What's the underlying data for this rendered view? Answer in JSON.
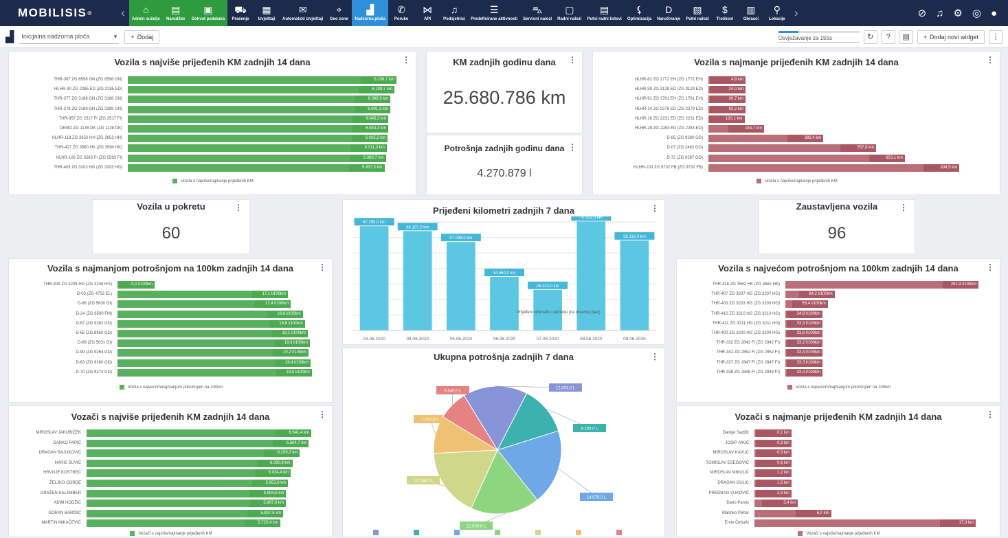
{
  "app": {
    "logo": "MOBILISIS",
    "logo_reg": "®"
  },
  "nav": [
    {
      "label": "Admin sučelje",
      "glyph": "⌂",
      "icon": "admin-icon",
      "state": "green"
    },
    {
      "label": "Narudžbe",
      "glyph": "▤",
      "icon": "orders-icon",
      "state": "green"
    },
    {
      "label": "Dohvat podataka",
      "glyph": "▣",
      "icon": "data-icon",
      "state": "green"
    },
    {
      "label": "Praćenje",
      "glyph": "⛟",
      "icon": "tracking-icon",
      "state": ""
    },
    {
      "label": "Izvještaji",
      "glyph": "▦",
      "icon": "reports-icon",
      "state": ""
    },
    {
      "label": "Automatski izvještaji",
      "glyph": "✉",
      "icon": "auto-reports-icon",
      "state": ""
    },
    {
      "label": "Geo zone",
      "glyph": "⌖",
      "icon": "geozone-icon",
      "state": ""
    },
    {
      "label": "Nadzorna ploča",
      "glyph": "▟",
      "icon": "dashboard-icon",
      "state": "active"
    },
    {
      "label": "Poruke",
      "glyph": "✆",
      "icon": "messages-icon",
      "state": ""
    },
    {
      "label": "API",
      "glyph": "⋈",
      "icon": "api-icon",
      "state": ""
    },
    {
      "label": "Podsjetnici",
      "glyph": "♫",
      "icon": "reminders-icon",
      "state": ""
    },
    {
      "label": "Predefinirane aktivnosti",
      "glyph": "☰",
      "icon": "activities-icon",
      "state": ""
    },
    {
      "label": "Servisni nalozi",
      "glyph": "⛍",
      "icon": "service-icon",
      "state": ""
    },
    {
      "label": "Radni nalozi",
      "glyph": "▢",
      "icon": "work-orders-icon",
      "state": ""
    },
    {
      "label": "Putni radni listovi",
      "glyph": "▤",
      "icon": "travel-sheets-icon",
      "state": ""
    },
    {
      "label": "Optimizacija",
      "glyph": "⚸",
      "icon": "optimization-icon",
      "state": ""
    },
    {
      "label": "Naručivanje",
      "glyph": "D",
      "icon": "ordering-icon",
      "state": ""
    },
    {
      "label": "Putni nalozi",
      "glyph": "▧",
      "icon": "travel-orders-icon",
      "state": ""
    },
    {
      "label": "Troškovi",
      "glyph": "$",
      "icon": "costs-icon",
      "state": ""
    },
    {
      "label": "Obrasci",
      "glyph": "▥",
      "icon": "forms-icon",
      "state": ""
    },
    {
      "label": "Lokacije",
      "glyph": "⚲",
      "icon": "locations-icon",
      "state": ""
    }
  ],
  "toolbar": {
    "dashboard_name": "Inicijalna nadzorna ploča",
    "add_label": "Dodaj",
    "refresh_text": "Osvježavanje za 155s",
    "refresh_progress": 0.25,
    "add_widget_label": "Dodaj novi widget"
  },
  "widgets": {
    "km_year": {
      "title": "KM zadnjih godinu dana",
      "value": "25.680.786 km"
    },
    "fuel_year": {
      "title": "Potrošnja zadnjih godinu dana",
      "value": "4.270.879 l"
    },
    "moving": {
      "title": "Vozila u pokretu",
      "value": "60"
    },
    "stopped": {
      "title": "Zaustavljena vozila",
      "value": "96"
    }
  },
  "chart_data": [
    {
      "id": "most_km",
      "type": "bar",
      "orientation": "horizontal",
      "title": "Vozila s najviše prijeđenih KM zadnjih 14 dana",
      "legend": "Vozila s najviše/najmanje prijeđenih KM",
      "color": "#59b05e",
      "xlim": [
        0,
        6300
      ],
      "categories": [
        "THR-387 ZG 8598 GN (ZG 8598 GN)",
        "HLHR-30 ZG 2285 ED (ZG 2285 ED)",
        "THR-377 ZG 3188 GN (ZG 3188 GN)",
        "THR-378 ZG 3189 GN (ZG 3189 GN)",
        "THR-357 ZG 2517 FI (ZG 2517 FI)",
        "DEMO ZG 1138 DK (ZG 1138 DK)",
        "HLHR-118 ZG 2652 HH (ZG 2652 HH)",
        "THR-417 ZG 3560 HK (ZG 3560 HK)",
        "HLHR-106 ZG 5583 FI (ZG 5583 FI)",
        "THR-403 ZG 3203 HG (ZG 3203 HG)"
      ],
      "values": [
        6236.7,
        6189.7,
        6096.9,
        6091.3,
        6045.3,
        6043.3,
        6035.3,
        6011.3,
        5989.7,
        5957.3
      ],
      "labels": [
        "6.236,7 km",
        "6.189,7 km",
        "6.096,9 km",
        "6.091,3 km",
        "6.045,3 km",
        "6.043,3 km",
        "6.035,3 km",
        "6.011,3 km",
        "5.989,7 km",
        "5.957,3 km"
      ]
    },
    {
      "id": "least_km",
      "type": "bar",
      "orientation": "horizontal",
      "title": "Vozila s najmanje prijeđenih KM zadnjih 14 dana",
      "legend": "Vozila s najviše/najmanje prijeđenih KM",
      "color": "#b96e78",
      "xlim": [
        0,
        900
      ],
      "categories": [
        "HLHR-82 ZG 1772 EH (ZG 1772 EH)",
        "HLHR-59 ZG 3129 ED (ZG 3129 ED)",
        "HLHR-91 ZG 1761 EH (ZG 1761 EH)",
        "HLHR-14 ZG 2279 ED (ZG 2279 ED)",
        "HLHR-16 ZG 2231 ED (ZG 2231 ED)",
        "HLHR-28 ZG 2283 ED (ZG 2283 ED)",
        "D-85 (ZG 9280 GD)",
        "D-07 (ZG 2462 GD)",
        "D-72 (ZG 9287 GD)",
        "HLHR-103 ZG 9732 FB (ZG 9732 FB)"
      ],
      "values": [
        4.8,
        24.0,
        26.7,
        93.2,
        120.1,
        184.7,
        382.4,
        557.8,
        653.1,
        834.5
      ],
      "labels": [
        "4,8 km",
        "24,0 km",
        "26,7 km",
        "93,2 km",
        "120,1 km",
        "184,7 km",
        "382,4 km",
        "557,8 km",
        "653,1 km",
        "834,5 km"
      ]
    },
    {
      "id": "least_cons",
      "type": "bar",
      "orientation": "horizontal",
      "title": "Vozila s najmanjom potrošnjom na 100km zadnjih 14 dana",
      "legend": "Vozila s najvećom/najmanjom potrošnjom na 100km",
      "color": "#59b05e",
      "xlim": [
        0,
        20
      ],
      "categories": [
        "THR-409 ZG 3208 HG (ZG 3208 HG)",
        "D-03 (ZG 4753 EL)",
        "D-88 (ZG 5630 GI)",
        "D-24 (ZG 6590 FM)",
        "D-67 (ZG 9262 GD)",
        "D-65 (ZG 8950 GD)",
        "D-89 (ZG 5631 GI)",
        "D-99 (ZG 9264 GD)",
        "D-63 (ZG 9260 GD)",
        "D-70 (ZG 9274 GD)"
      ],
      "values": [
        0.0,
        17.1,
        17.4,
        18.6,
        18.8,
        19.1,
        19.3,
        19.2,
        19.4,
        19.5
      ],
      "labels": [
        "0,0 l/100km",
        "17,1 l/100km",
        "17,4 l/100km",
        "18,6 l/100km",
        "18,8 l/100km",
        "19,1 l/100km",
        "19,3 l/100km",
        "19,2 l/100km",
        "19,4 l/100km",
        "19,5 l/100km"
      ]
    },
    {
      "id": "most_cons",
      "type": "bar",
      "orientation": "horizontal",
      "title": "Vozila s najvećom potrošnjom na 100km zadnjih 14 dana",
      "legend": "Vozila s najvećom/najmanjom potrošnjom na 100km",
      "color": "#b96e78",
      "xlim": [
        0,
        260
      ],
      "categories": [
        "THR-418 ZG 3562 HK (ZG 3562 HK)",
        "THR-407 ZG 3207 HG (ZG 3207 HG)",
        "THR-403 ZG 3203 HG (ZG 3203 HG)",
        "THR-410 ZG 3210 HG (ZG 3210 HG)",
        "THR-411 ZG 3211 HG (ZG 3211 HG)",
        "THR-400 ZG 3200 HG (ZG 3200 HG)",
        "THR-332 ZG 2842 FI (ZG 2842 FI)",
        "THR-342 ZG 2852 FI (ZG 2852 FI)",
        "THR-337 ZG 2847 FI (ZG 2847 FI)",
        "THR-338 ZG 2848 FI (ZG 2848 FI)"
      ],
      "values": [
        252.3,
        64.2,
        55.4,
        34.8,
        33.3,
        33.6,
        33.2,
        33.3,
        33.3,
        33.4
      ],
      "labels": [
        "252,3 l/100km",
        "64,2 l/100km",
        "55,4 l/100km",
        "34,8 l/100km",
        "33,3 l/100km",
        "33,6 l/100km",
        "33,2 l/100km",
        "33,3 l/100km",
        "33,3 l/100km",
        "33,4 l/100km"
      ]
    },
    {
      "id": "drivers_most",
      "type": "bar",
      "orientation": "horizontal",
      "title": "Vozači s najviše prijeđenih KM zadnjih 14 dana",
      "legend": "Vozači s najviše/najmanje prijeđenih KM",
      "color": "#59b05e",
      "xlim": [
        0,
        6800
      ],
      "categories": [
        "MIROSLAV JAKUBIČEK",
        "DARKO PAPIĆ",
        "DRAGAN BAJUKOVIĆ",
        "HARIS ŠUVIĆ",
        "HRVOJE KOSTREC",
        "ŽELJKO CORDE",
        "DRAŽEN KALEMBER",
        "ADIM HODŽIĆ",
        "GORAN BARIŠIĆ",
        "MARTIN MIKAČEVIĆ"
      ],
      "values": [
        6641.4,
        6564.7,
        6299.3,
        6080.8,
        6034.4,
        5953.8,
        5894.6,
        5887.6,
        5807.5,
        5723.4
      ],
      "labels": [
        "6.641,4 km",
        "6.564,7 km",
        "6.299,3 km",
        "6.080,8 km",
        "6.034,4 km",
        "5.953,8 km",
        "5.894,6 km",
        "5.887,6 km",
        "5.807,5 km",
        "5.723,4 km"
      ]
    },
    {
      "id": "drivers_least",
      "type": "bar",
      "orientation": "horizontal",
      "title": "Vozači s najmanje prijeđenih KM zadnjih 14 dana",
      "legend": "Vozači s najviše/najmanje prijeđenih KM",
      "color": "#b96e78",
      "xlim": [
        0,
        18
      ],
      "categories": [
        "Damjel Sadžić",
        "JOSIP IVKIĆ",
        "MIROSLAV KAVUC",
        "TOMISLAV ESEGOVIĆ",
        "MIROSLAV MIKULIĆ",
        "DRAGAN GULIC",
        "PREDRAG VUKOVIĆ",
        "Dario Parvic",
        "Marinko Pehar",
        "Ervin Čehulić"
      ],
      "values": [
        0.1,
        0.3,
        0.3,
        0.6,
        1.2,
        1.5,
        2.9,
        3.4,
        6.0,
        17.3
      ],
      "labels": [
        "0,1 km",
        "0,3 km",
        "0,3 km",
        "0,6 km",
        "1,2 km",
        "1,5 km",
        "2,9 km",
        "3,4 km",
        "6,0 km",
        "17,3 km"
      ]
    },
    {
      "id": "km7",
      "type": "bar",
      "orientation": "vertical",
      "title": "Prijeđeni kilometri zadnjih 7 dana",
      "legend": "Prijeđeni kilometri u periodu (na dnevnoj bazi)",
      "color": "#5bc7e3",
      "ylim": [
        0,
        70000
      ],
      "categories": [
        "03.06.2020",
        "04.06.2020",
        "05.06.2020",
        "06.06.2020",
        "07.06.2020",
        "08.06.2020",
        "09.06.2020"
      ],
      "values": [
        67255.0,
        64107.0,
        57098.0,
        34560.0,
        26223.0,
        70333.0,
        58116.0
      ],
      "labels": [
        "67.255,0 km",
        "64.107,0 km",
        "57.098,0 km",
        "34.560,0 km",
        "26.223,0 km",
        "70.333,0 km",
        "58.116,0 km"
      ]
    },
    {
      "id": "fuel7",
      "type": "pie",
      "title": "Ukupna potrošnja zadnjih 7 dana",
      "slices": [
        {
          "value": 12003.0,
          "label": "12.003,0 L",
          "color": "#8894d8"
        },
        {
          "value": 9230.0,
          "label": "9.230,0 L",
          "color": "#3bb2ae"
        },
        {
          "value": 14075.0,
          "label": "14.075,0 L",
          "color": "#6ea8e6"
        },
        {
          "value": 12839.0,
          "label": "12.839,0 L",
          "color": "#8dd67f"
        },
        {
          "value": 12788.0,
          "label": "12.788,0 L",
          "color": "#cfd88a"
        },
        {
          "value": 7000.0,
          "label": "7.000,0 L",
          "color": "#f0c073"
        },
        {
          "value": 5540.0,
          "label": "5.540,0 L",
          "color": "#e58282"
        }
      ]
    }
  ]
}
